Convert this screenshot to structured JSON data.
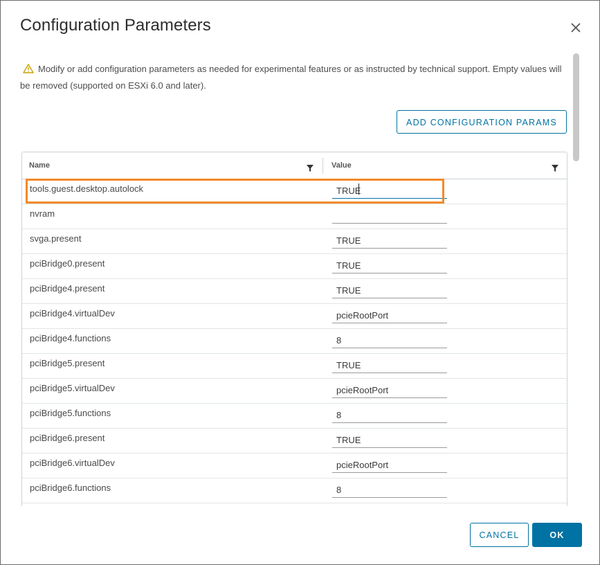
{
  "dialog": {
    "title": "Configuration Parameters",
    "info_text": "Modify or add configuration parameters as needed for experimental features or as instructed by technical support. Empty values will be removed (supported on ESXi 6.0 and later).",
    "add_button_label": "ADD CONFIGURATION PARAMS",
    "cancel_label": "CANCEL",
    "ok_label": "OK"
  },
  "colors": {
    "accent": "#0072a3",
    "highlight": "#f28a2a",
    "warning": "#c9a300"
  },
  "icons": {
    "warning": "warning-triangle-icon",
    "close": "close-icon",
    "filter": "filter-icon"
  },
  "grid": {
    "columns": [
      "Name",
      "Value"
    ],
    "rows": [
      {
        "name": "tools.guest.desktop.autolock",
        "value": "TRUE"
      },
      {
        "name": "nvram",
        "value": ""
      },
      {
        "name": "svga.present",
        "value": "TRUE"
      },
      {
        "name": "pciBridge0.present",
        "value": "TRUE"
      },
      {
        "name": "pciBridge4.present",
        "value": "TRUE"
      },
      {
        "name": "pciBridge4.virtualDev",
        "value": "pcieRootPort"
      },
      {
        "name": "pciBridge4.functions",
        "value": "8"
      },
      {
        "name": "pciBridge5.present",
        "value": "TRUE"
      },
      {
        "name": "pciBridge5.virtualDev",
        "value": "pcieRootPort"
      },
      {
        "name": "pciBridge5.functions",
        "value": "8"
      },
      {
        "name": "pciBridge6.present",
        "value": "TRUE"
      },
      {
        "name": "pciBridge6.virtualDev",
        "value": "pcieRootPort"
      },
      {
        "name": "pciBridge6.functions",
        "value": "8"
      }
    ]
  }
}
